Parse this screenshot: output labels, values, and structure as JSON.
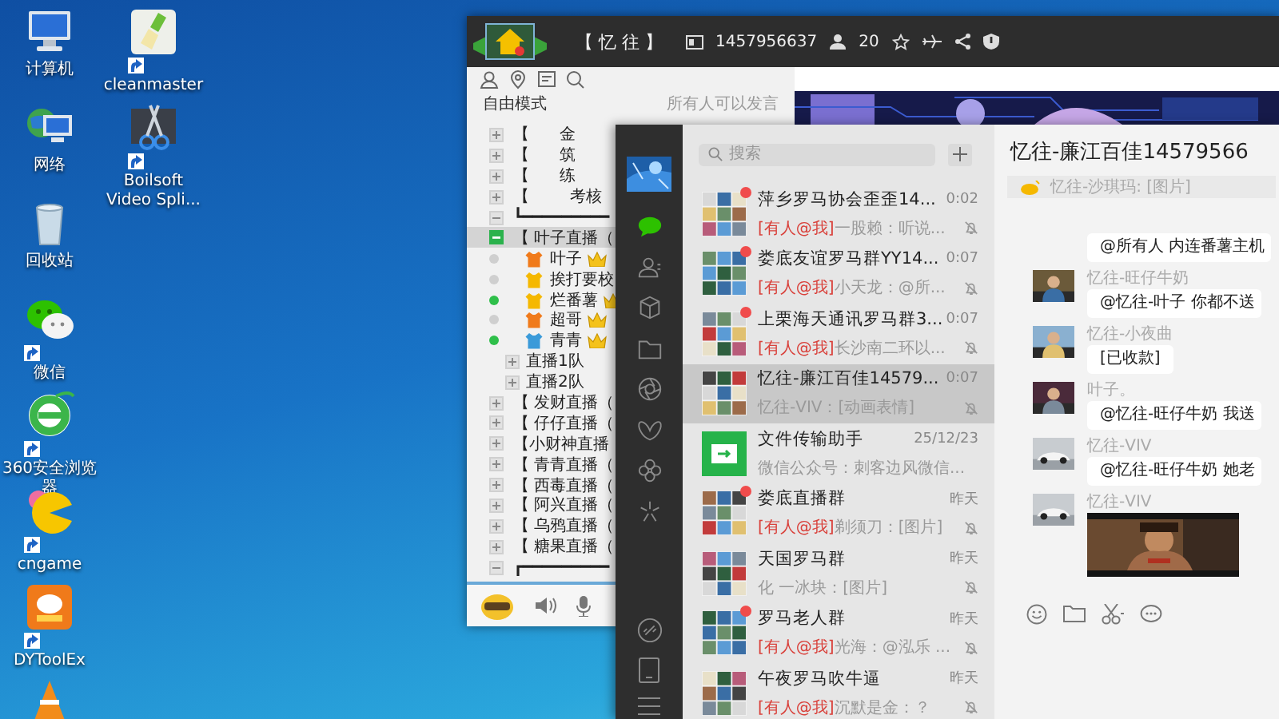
{
  "desktop": {
    "column_1": [
      {
        "kind": "computer",
        "label": "计算机"
      },
      {
        "kind": "network",
        "label": "网络"
      },
      {
        "kind": "recycle",
        "label": "回收站"
      },
      {
        "kind": "wechat",
        "label": "微信",
        "shortcut": true
      },
      {
        "kind": "browser",
        "label": "360安全浏览器",
        "shortcut": true
      },
      {
        "kind": "game",
        "label": "cngame",
        "shortcut": true
      },
      {
        "kind": "app",
        "label": "DYToolEx",
        "shortcut": true
      },
      {
        "kind": "cone"
      }
    ],
    "column_2": [
      {
        "kind": "cleaner",
        "label": "cleanmaster",
        "shortcut": true
      },
      {
        "kind": "scissors",
        "label": "Boilsoft Video Spli...",
        "shortcut": true
      }
    ]
  },
  "yy_window": {
    "title_bar": {
      "channel_name": "【 忆 往 】",
      "channel_id": "1457956637",
      "user_count": "20"
    },
    "mode": "自由模式",
    "mode_note": "所有人可以发言",
    "tree": [
      {
        "kind": "channel",
        "label": "【      金",
        "expanded": false,
        "selected": false
      },
      {
        "kind": "channel",
        "label": "【      筑",
        "expanded": false,
        "selected": false
      },
      {
        "kind": "channel",
        "label": "【      练",
        "expanded": false,
        "selected": false
      },
      {
        "kind": "channel",
        "label": "【        考核",
        "expanded": false,
        "selected": false
      },
      {
        "kind": "separator",
        "label": "┗━━━━━━━━━"
      },
      {
        "kind": "channel",
        "label": "【 叶子直播（",
        "expanded": true,
        "selected": true,
        "children": [
          {
            "kind": "member",
            "label": "叶子",
            "online": false,
            "color": "#f07a1a",
            "crown": true,
            "selected": false
          },
          {
            "kind": "member",
            "label": "挨打要校",
            "online": false,
            "color": "#f5b800",
            "crown": false,
            "selected": false
          },
          {
            "kind": "member",
            "label": "烂番薯",
            "online": true,
            "color": "#f5b800",
            "crown": true,
            "selected": false
          },
          {
            "kind": "member",
            "label": "超哥",
            "online": false,
            "color": "#f07a1a",
            "crown": true,
            "selected": false
          },
          {
            "kind": "member",
            "label": "青青",
            "online": true,
            "color": "#3a9ad9",
            "crown": true,
            "selected": false
          },
          {
            "kind": "group",
            "label": "直播1队",
            "expanded": false,
            "selected": false
          },
          {
            "kind": "group",
            "label": "直播2队",
            "expanded": false,
            "selected": false
          }
        ]
      },
      {
        "kind": "channel",
        "label": "【 发财直播（",
        "expanded": false,
        "selected": false
      },
      {
        "kind": "channel",
        "label": "【 仔仔直播（",
        "expanded": false,
        "selected": false
      },
      {
        "kind": "channel",
        "label": "【小财神直播",
        "expanded": false,
        "selected": false
      },
      {
        "kind": "channel",
        "label": "【 青青直播（",
        "expanded": false,
        "selected": false
      },
      {
        "kind": "channel",
        "label": "【 西毒直播（",
        "expanded": false,
        "selected": false
      },
      {
        "kind": "channel",
        "label": "【 阿兴直播（",
        "expanded": false,
        "selected": false
      },
      {
        "kind": "channel",
        "label": "【 乌鸦直播（",
        "expanded": false,
        "selected": false
      },
      {
        "kind": "channel",
        "label": "【 糖果直播（",
        "expanded": false,
        "selected": false
      },
      {
        "kind": "separator",
        "label": "┏━━━━━━━━━"
      }
    ]
  },
  "wechat": {
    "nav": [
      {
        "kind": "chat",
        "selected": true
      },
      {
        "kind": "contacts",
        "selected": false
      },
      {
        "kind": "cube",
        "selected": false
      },
      {
        "kind": "folder",
        "selected": false
      },
      {
        "kind": "aperture",
        "selected": false
      },
      {
        "kind": "butterfly",
        "selected": false
      },
      {
        "kind": "flower",
        "selected": false
      },
      {
        "kind": "sparkle",
        "selected": false
      }
    ],
    "search": {
      "placeholder": "搜索"
    },
    "chats": [
      {
        "kind": "group",
        "title": "萍乡罗马协会歪歪14...",
        "time": "0:02",
        "mention": "[有人@我]",
        "preview": "一股赖：听说...",
        "unread": true,
        "muted": true,
        "selected": false
      },
      {
        "kind": "group",
        "title": "娄底友谊罗马群YY14...",
        "time": "0:07",
        "mention": "[有人@我]",
        "preview": "小天龙：@所...",
        "unread": true,
        "muted": true,
        "selected": false
      },
      {
        "kind": "group",
        "title": "上栗海天通讯罗马群3...",
        "time": "0:07",
        "mention": "[有人@我]",
        "preview": "长沙南二环以...",
        "unread": true,
        "muted": true,
        "selected": false
      },
      {
        "kind": "group",
        "title": "忆往-廉江百佳14579...",
        "time": "0:07",
        "preview": "忆往-VIV：[动画表情]",
        "unread": false,
        "muted": true,
        "selected": true
      },
      {
        "kind": "file",
        "title": "文件传输助手",
        "time": "25/12/23",
        "preview": "微信公众号：刺客边风微信...",
        "unread": false,
        "muted": false,
        "selected": false
      },
      {
        "kind": "group",
        "title": "娄底直播群",
        "time": "昨天",
        "mention": "[有人@我]",
        "preview": "剃须刀：[图片]",
        "unread": true,
        "muted": true,
        "selected": false
      },
      {
        "kind": "group",
        "title": "天国罗马群",
        "time": "昨天",
        "preview": "化 一冰块：[图片]",
        "unread": false,
        "muted": true,
        "selected": false
      },
      {
        "kind": "group",
        "title": "罗马老人群",
        "time": "昨天",
        "mention": "[有人@我]",
        "preview": "光海：@泓乐 ...",
        "unread": true,
        "muted": true,
        "selected": false
      },
      {
        "kind": "group",
        "title": "午夜罗马吹牛逼",
        "time": "昨天",
        "mention": "[有人@我]",
        "preview": "沉默是金：？",
        "unread": false,
        "muted": true,
        "selected": false
      }
    ],
    "conversation": {
      "title": "忆往-廉江百佳14579566",
      "pinned": "忆往-沙琪玛: [图片]",
      "messages": [
        {
          "kind": "text",
          "text": "@所有人 内连番薯主机"
        },
        {
          "kind": "text",
          "sender": "忆往-旺仔牛奶",
          "text": "@忆往-叶子 你都不送"
        },
        {
          "kind": "text",
          "sender": "忆往-小夜曲",
          "text": "[已收款]"
        },
        {
          "kind": "text",
          "sender": "叶子。",
          "text": "@忆往-旺仔牛奶 我送"
        },
        {
          "kind": "text",
          "sender": "忆往-VIV",
          "text": "@忆往-旺仔牛奶 她老"
        },
        {
          "sender": "忆往-VIV"
        }
      ]
    }
  }
}
